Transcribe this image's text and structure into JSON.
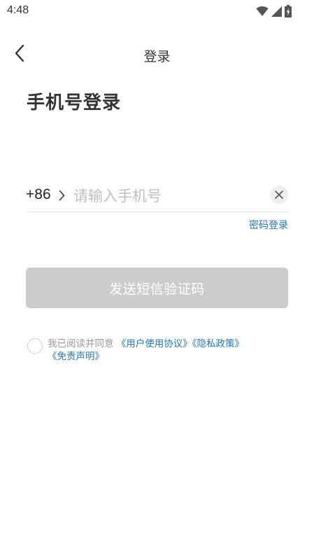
{
  "status_bar": {
    "time": "4:48",
    "icons": [
      "wifi-icon",
      "cellular-signal-icon",
      "battery-charging-icon"
    ]
  },
  "nav": {
    "title": "登录",
    "back_icon": "chevron-left-icon"
  },
  "page": {
    "heading": "手机号登录"
  },
  "phone": {
    "country_code": "+86",
    "value": "",
    "placeholder": "请输入手机号",
    "clear_icon": "close-icon"
  },
  "links": {
    "password_login": "密码登录"
  },
  "actions": {
    "send_code_label": "发送短信验证码"
  },
  "agreement": {
    "prefix": "我已阅读并同意",
    "user_agreement": "《用户使用协议》",
    "privacy_policy": "《隐私政策》",
    "disclaimer": "《免责声明》"
  },
  "colors": {
    "link": "#2676b4",
    "button_disabled_bg": "#cccccc",
    "text_primary": "#333333",
    "placeholder": "#c0c0c0"
  }
}
